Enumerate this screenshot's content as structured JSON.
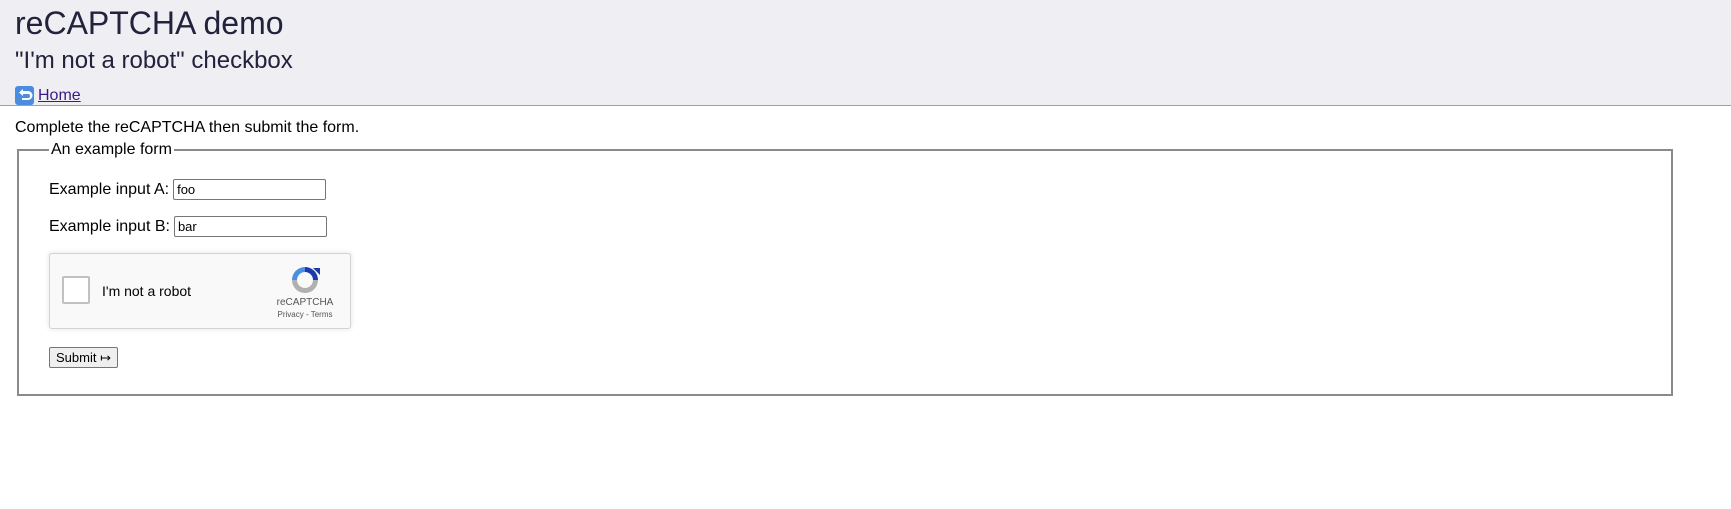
{
  "header": {
    "title": "reCAPTCHA demo",
    "subtitle": "\"I'm not a robot\" checkbox",
    "home_link": {
      "icon": "return-arrow-icon",
      "label": "Home"
    }
  },
  "main": {
    "intro": "Complete the reCAPTCHA then submit the form.",
    "form": {
      "legend": "An example form",
      "input_a": {
        "label": "Example input A:",
        "value": "foo"
      },
      "input_b": {
        "label": "Example input B:",
        "value": "bar"
      },
      "recaptcha": {
        "checkbox_label": "I'm not a robot",
        "brand": "reCAPTCHA",
        "privacy": "Privacy",
        "separator": "-",
        "terms": "Terms",
        "icon": "recaptcha-logo-icon"
      },
      "submit_label": "Submit ↦"
    }
  },
  "colors": {
    "header_bg": "#eeeef3",
    "heading": "#22223c",
    "link": "#3a1a88",
    "recaptcha_blue": "#1c3aa9",
    "recaptcha_lightblue": "#4a90e2",
    "recaptcha_gray": "#b0b0b0"
  }
}
